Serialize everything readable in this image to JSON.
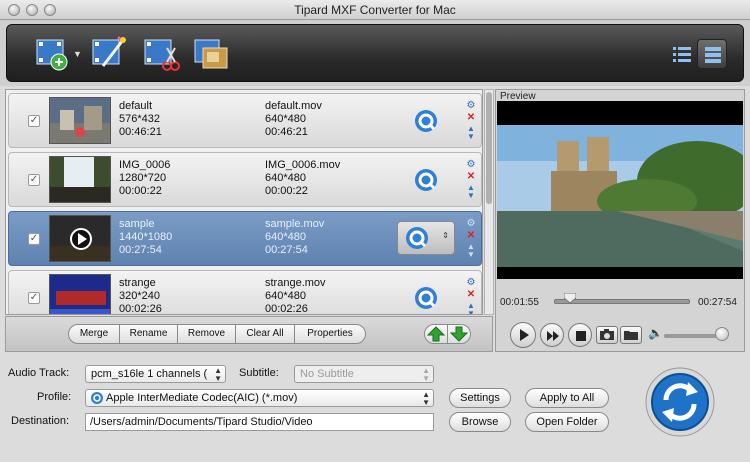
{
  "window": {
    "title": "Tipard MXF Converter for Mac"
  },
  "toolbar": {
    "buttons": [
      {
        "name": "add-file-icon"
      },
      {
        "name": "edit-icon"
      },
      {
        "name": "clip-icon"
      },
      {
        "name": "merge-icon"
      }
    ],
    "views": [
      {
        "name": "list-view-icon"
      },
      {
        "name": "detail-view-icon"
      }
    ]
  },
  "files": [
    {
      "name": "default",
      "resolution": "576*432",
      "duration": "00:46:21",
      "out_name": "default.mov",
      "out_resolution": "640*480",
      "out_duration": "00:46:21",
      "checked": true,
      "selected": false
    },
    {
      "name": "IMG_0006",
      "resolution": "1280*720",
      "duration": "00:00:22",
      "out_name": "IMG_0006.mov",
      "out_resolution": "640*480",
      "out_duration": "00:00:22",
      "checked": true,
      "selected": false
    },
    {
      "name": "sample",
      "resolution": "1440*1080",
      "duration": "00:27:54",
      "out_name": "sample.mov",
      "out_resolution": "640*480",
      "out_duration": "00:27:54",
      "checked": true,
      "selected": true
    },
    {
      "name": "strange",
      "resolution": "320*240",
      "duration": "00:02:26",
      "out_name": "strange.mov",
      "out_resolution": "640*480",
      "out_duration": "00:02:26",
      "checked": true,
      "selected": false
    }
  ],
  "list_actions": {
    "merge": "Merge",
    "rename": "Rename",
    "remove": "Remove",
    "clear_all": "Clear All",
    "properties": "Properties"
  },
  "preview": {
    "label": "Preview",
    "current_time": "00:01:55",
    "total_time": "00:27:54",
    "progress": 0.069,
    "volume": 0.9
  },
  "settings": {
    "audio_track_label": "Audio Track:",
    "audio_track_value": "pcm_s16le 1 channels (",
    "subtitle_label": "Subtitle:",
    "subtitle_value": "No Subtitle",
    "profile_label": "Profile:",
    "profile_value": "Apple InterMediate Codec(AIC) (*.mov)",
    "destination_label": "Destination:",
    "destination_value": "/Users/admin/Documents/Tipard Studio/Video",
    "settings_button": "Settings",
    "apply_all_button": "Apply to All",
    "browse_button": "Browse",
    "open_folder_button": "Open Folder"
  },
  "colors": {
    "selected_row": "#6a8cba",
    "convert_blue": "#1e73c8",
    "up_arrow": "#2fa52f"
  }
}
